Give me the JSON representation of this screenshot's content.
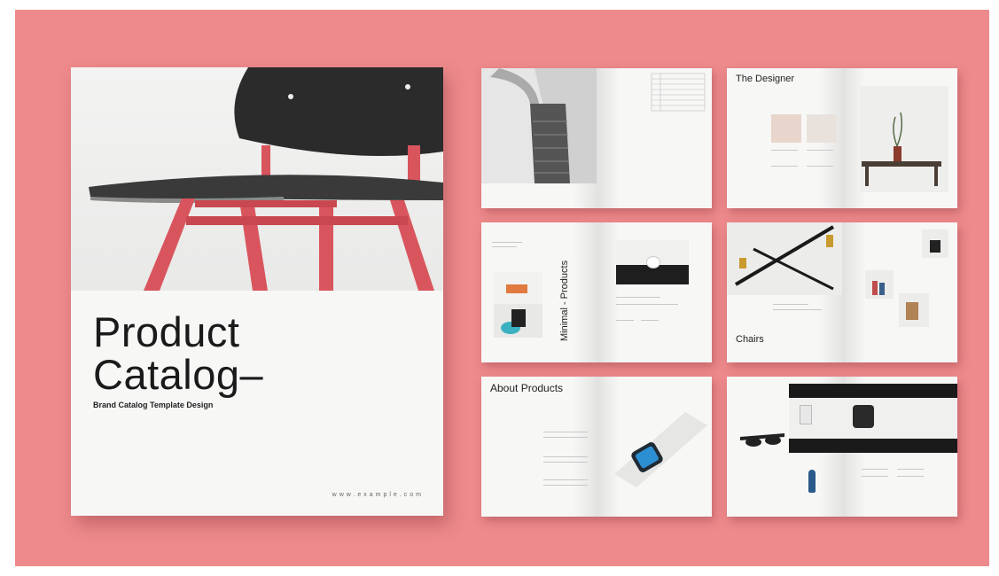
{
  "cover": {
    "title_line1": "Product",
    "title_line2": "Catalog–",
    "subtitle": "Brand Catalog Template Design",
    "url": "www.example.com"
  },
  "spreads": {
    "designer_heading": "The Designer",
    "minimal_heading": "Minimal - Products",
    "chairs_heading": "Chairs",
    "about_heading": "About Products"
  },
  "colors": {
    "background": "#ee8a8c",
    "chair_frame": "#d9555d",
    "chair_seat": "#2b2b2b"
  }
}
